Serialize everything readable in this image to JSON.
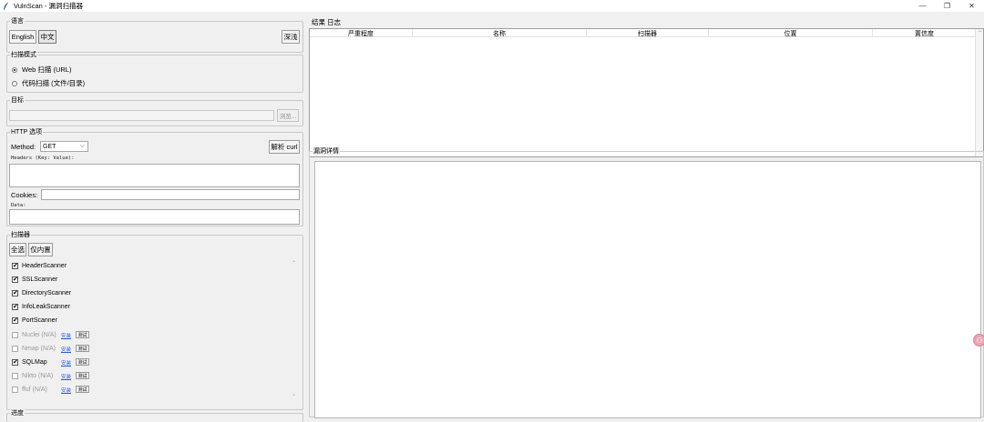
{
  "window": {
    "title": "VulnScan - 漏洞扫描器",
    "controls": {
      "minimize": "—",
      "restore": "❐",
      "close": "✕"
    }
  },
  "language": {
    "group_label": "语言",
    "english_label": "English",
    "chinese_label": "中文",
    "theme_label": "深浅"
  },
  "scan_mode": {
    "group_label": "扫描模式",
    "web_label": "Web 扫描 (URL)",
    "code_label": "代码扫描 (文件/目录)",
    "selected": "web"
  },
  "target": {
    "group_label": "目标",
    "value": "",
    "browse_label": "浏览..."
  },
  "http": {
    "group_label": "HTTP 选项",
    "method_label": "Method:",
    "method_value": "GET",
    "parse_curl_label": "解析 curl",
    "headers_label": "Headers (Key: Value):",
    "cookies_label": "Cookies:",
    "data_label": "Data:"
  },
  "scanners": {
    "group_label": "扫描器",
    "select_all_label": "全选",
    "builtin_only_label": "仅内置",
    "items": [
      {
        "name": "HeaderScanner",
        "checked": "✔",
        "enabled": true
      },
      {
        "name": "SSLScanner",
        "checked": "✔",
        "enabled": true
      },
      {
        "name": "DirectoryScanner",
        "checked": "✔",
        "enabled": true
      },
      {
        "name": "InfoLeakScanner",
        "checked": "✔",
        "enabled": true
      },
      {
        "name": "PortScanner",
        "checked": "✔",
        "enabled": true
      },
      {
        "name": "Nuclei (N/A)",
        "checked": "",
        "enabled": false,
        "install": "安装",
        "test": "测试"
      },
      {
        "name": "Nmap (N/A)",
        "checked": "",
        "enabled": false,
        "install": "安装",
        "test": "测试"
      },
      {
        "name": "SQLMap",
        "checked": "✔",
        "enabled": true,
        "install": "安装",
        "test": "测试"
      },
      {
        "name": "Nikto (N/A)",
        "checked": "",
        "enabled": false,
        "install": "安装",
        "test": "测试"
      },
      {
        "name": "ffuf (N/A)",
        "checked": "",
        "enabled": false,
        "install": "安装",
        "test": "测试"
      }
    ]
  },
  "progress": {
    "group_label": "进度"
  },
  "results": {
    "tab_results": "结果",
    "tab_log": "日志",
    "columns": [
      "严重程度",
      "名称",
      "扫描器",
      "位置",
      "置信度"
    ]
  },
  "details": {
    "group_label": "漏洞详情"
  },
  "icons": {
    "scroll_up": "⌃",
    "scroll_down": "⌄",
    "dropdown": "⌵",
    "float": "⚇"
  }
}
